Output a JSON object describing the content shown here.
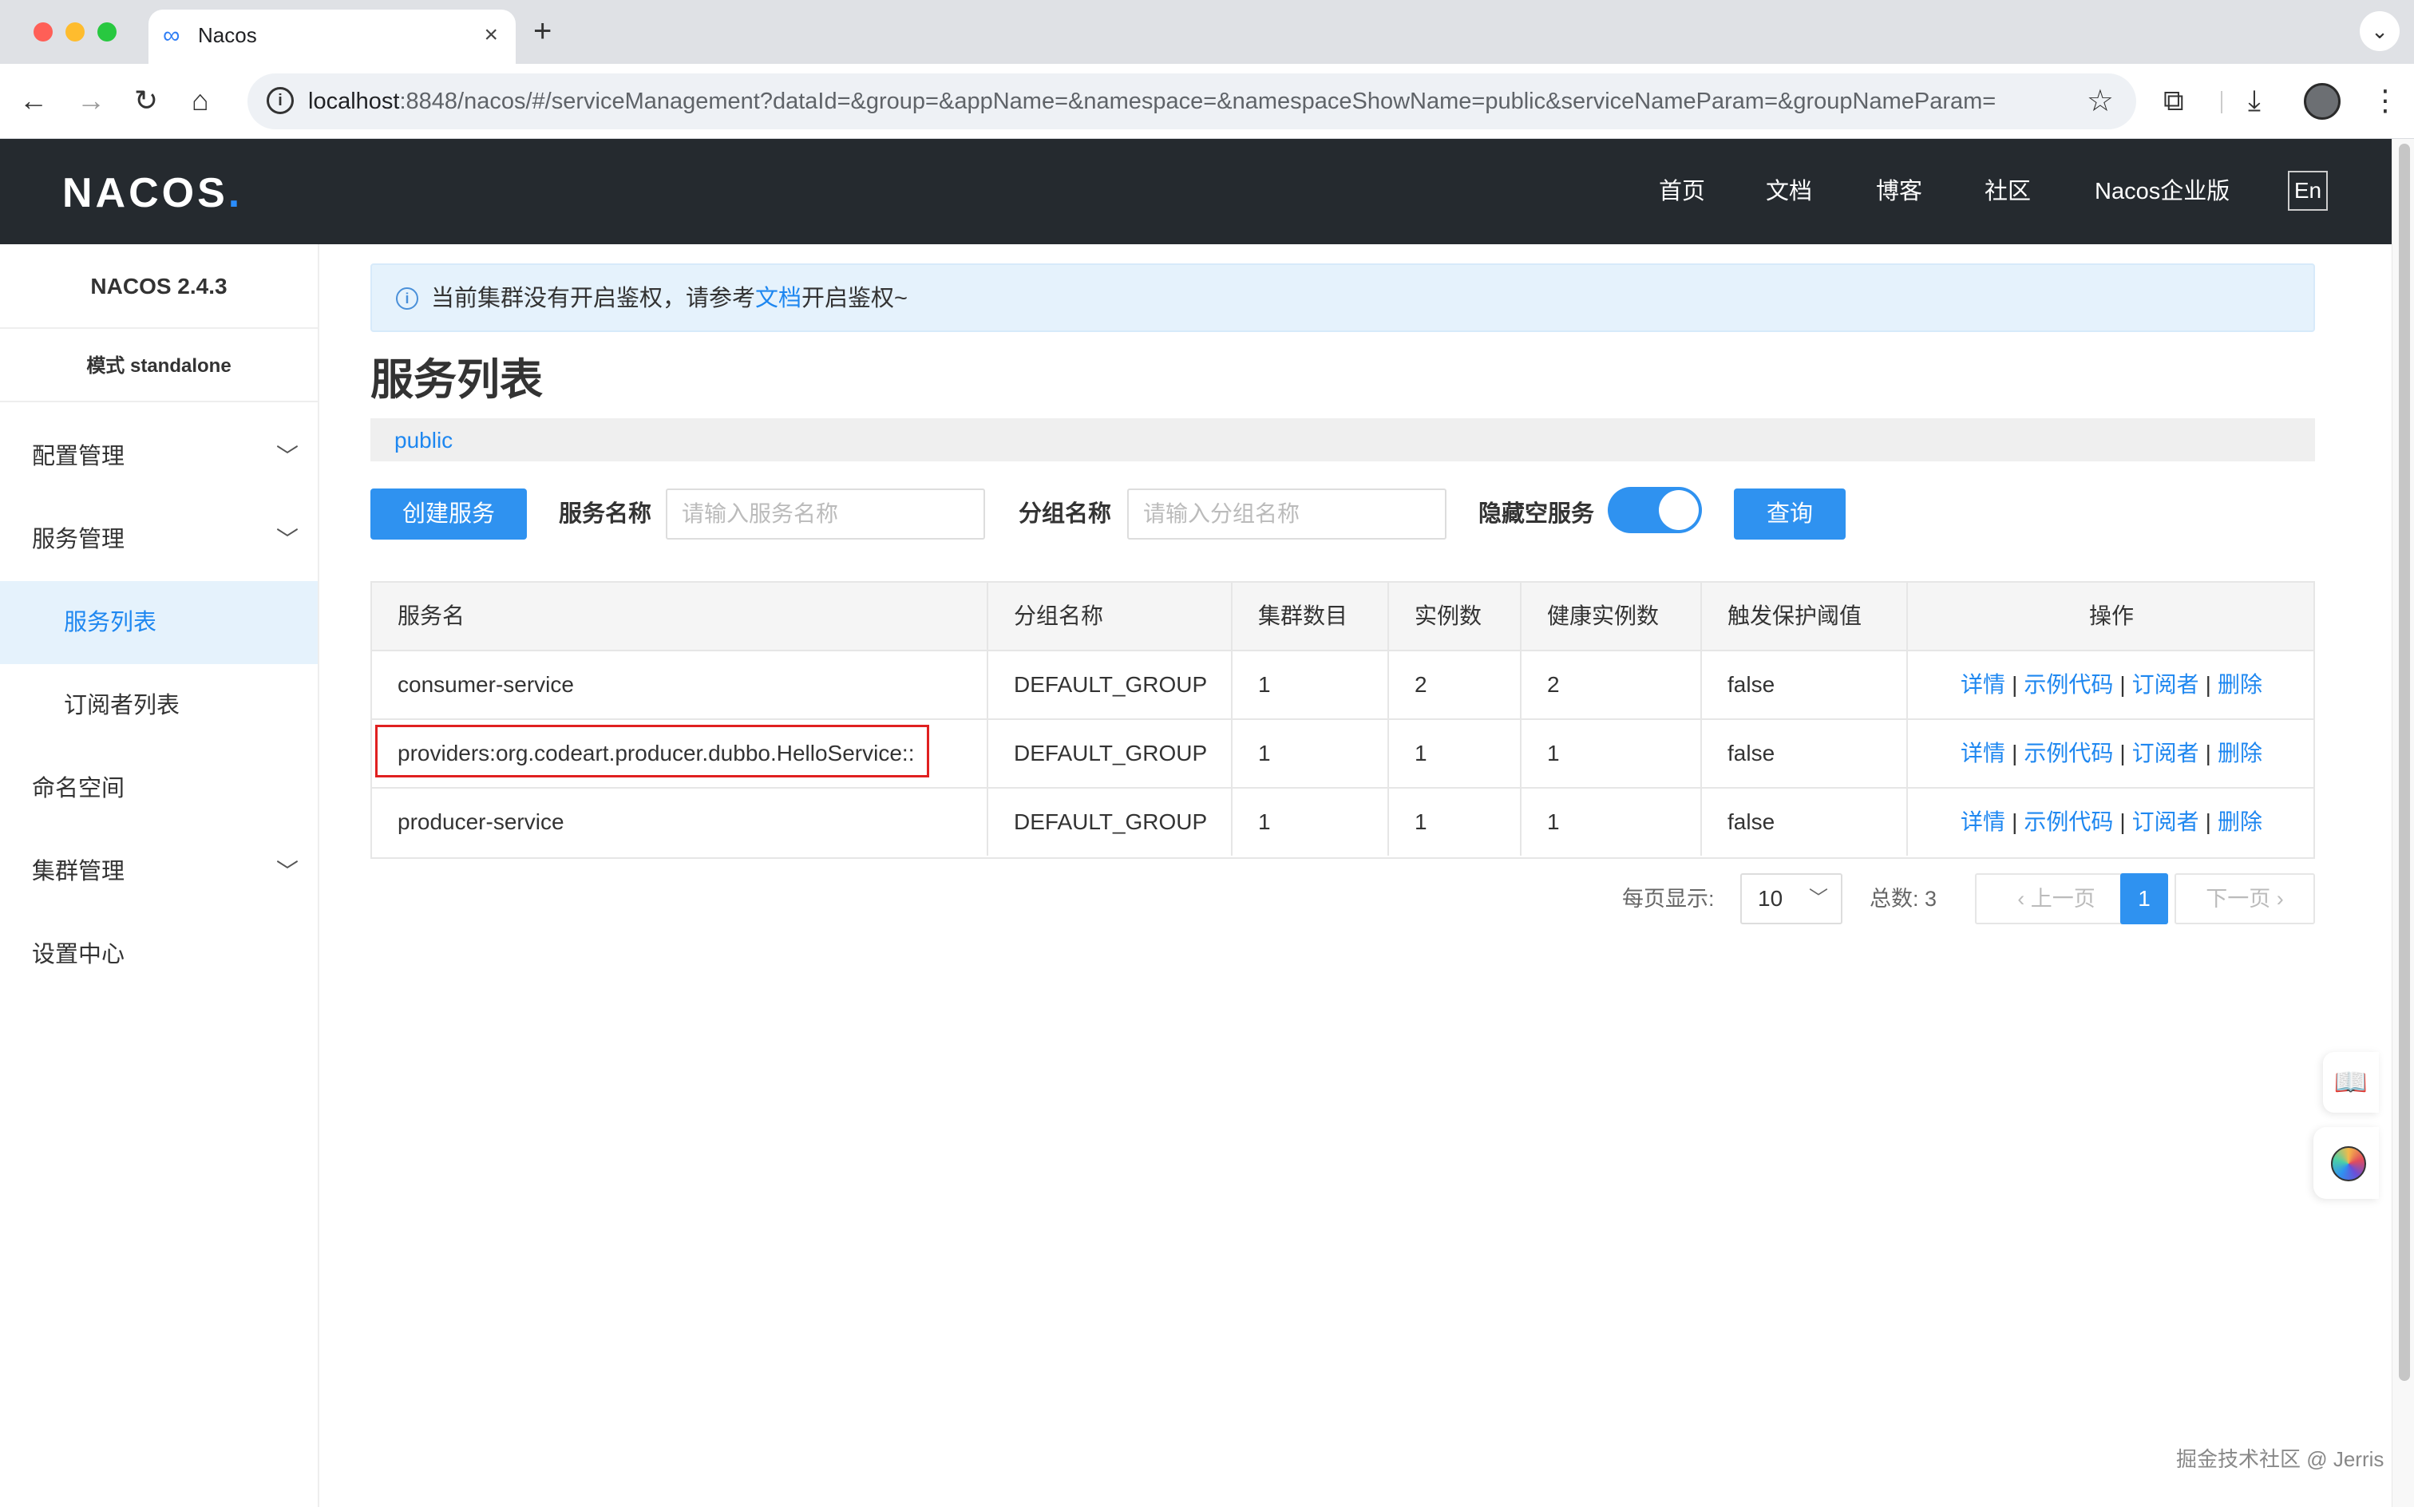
{
  "browser": {
    "tab_title": "Nacos",
    "url_host": "localhost",
    "url_rest": ":8848/nacos/#/serviceManagement?dataId=&group=&appName=&namespace=&namespaceShowName=public&serviceNameParam=&groupNameParam="
  },
  "header": {
    "logo": "NACOS",
    "logo_dot": ".",
    "nav": [
      "首页",
      "文档",
      "博客",
      "社区",
      "Nacos企业版"
    ],
    "lang": "En"
  },
  "sidebar": {
    "version": "NACOS 2.4.3",
    "mode": "模式 standalone",
    "items": [
      {
        "label": "配置管理",
        "expandable": true
      },
      {
        "label": "服务管理",
        "expandable": true
      },
      {
        "label": "服务列表",
        "active": true,
        "sub": true
      },
      {
        "label": "订阅者列表",
        "sub": true
      },
      {
        "label": "命名空间"
      },
      {
        "label": "集群管理",
        "expandable": true
      },
      {
        "label": "设置中心"
      }
    ]
  },
  "notice": {
    "before": "当前集群没有开启鉴权，请参考",
    "link": "文档",
    "after": "开启鉴权~"
  },
  "page": {
    "title": "服务列表",
    "namespace": "public"
  },
  "filters": {
    "create_button": "创建服务",
    "service_name_label": "服务名称",
    "service_name_placeholder": "请输入服务名称",
    "group_name_label": "分组名称",
    "group_name_placeholder": "请输入分组名称",
    "hide_empty_label": "隐藏空服务",
    "hide_empty_on": true,
    "query_button": "查询"
  },
  "table": {
    "columns": [
      "服务名",
      "分组名称",
      "集群数目",
      "实例数",
      "健康实例数",
      "触发保护阈值",
      "操作"
    ],
    "rows": [
      [
        "consumer-service",
        "DEFAULT_GROUP",
        "1",
        "2",
        "2",
        "false"
      ],
      [
        "providers:org.codeart.producer.dubbo.HelloService::",
        "DEFAULT_GROUP",
        "1",
        "1",
        "1",
        "false"
      ],
      [
        "producer-service",
        "DEFAULT_GROUP",
        "1",
        "1",
        "1",
        "false"
      ]
    ],
    "actions": [
      "详情",
      "示例代码",
      "订阅者",
      "删除"
    ],
    "action_sep": "|"
  },
  "pagination": {
    "per_page_label": "每页显示:",
    "per_page_value": "10",
    "total_label": "总数: 3",
    "prev": "上一页",
    "current": "1",
    "next": "下一页"
  },
  "watermark": "掘金技术社区 @ Jerris",
  "colors": {
    "accent": "#2f92f0",
    "header_bg": "#252a2f",
    "highlight_box": "#e02020"
  }
}
